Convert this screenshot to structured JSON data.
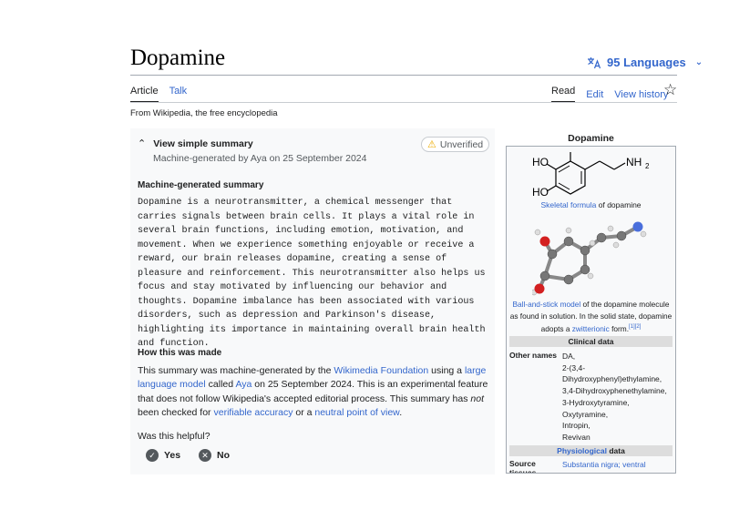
{
  "article": {
    "title": "Dopamine",
    "languages": "95 Languages",
    "tabs_left": [
      "Article",
      "Talk"
    ],
    "tabs_right": [
      "Read",
      "Edit",
      "View history"
    ],
    "tagline": "From Wikipedia, the free encyclopedia"
  },
  "summary": {
    "title": "View simple summary",
    "badge": "Unverified",
    "meta": "Machine-generated by Aya on 25 September 2024",
    "section_heading": "Machine-generated summary",
    "text": "Dopamine is a neurotransmitter, a chemical messenger that carries signals between brain cells. It plays a vital role in several brain functions, including emotion, motivation, and movement. When we experience something enjoyable or receive a reward, our brain releases dopamine, creating a sense of pleasure and reinforcement. This neurotransmitter also helps us focus and stay motivated by influencing our behavior and thoughts. Dopamine imbalance has been associated with various disorders, such as depression and Parkinson's disease, highlighting its importance in maintaining overall brain health and function.",
    "how_heading": "How this was made",
    "how": {
      "p1": "This summary was machine-generated by the ",
      "l1": "Wikimedia Foundation",
      "p2": " using a ",
      "l2": "large language model",
      "p3": " called ",
      "l3": "Aya",
      "p4": " on 25 September 2024. This is an experimental feature that does not follow Wikipedia's accepted editorial process. This summary has ",
      "em": "not",
      "p5": " been checked for ",
      "l4": "verifiable accuracy",
      "p6": " or a ",
      "l5": "neutral point of view",
      "p7": "."
    },
    "helpful_q": "Was this helpful?",
    "yes": "Yes",
    "no": "No"
  },
  "infobox": {
    "title": "Dopamine",
    "struct_labels": {
      "ho1": "HO",
      "ho2": "HO",
      "nh2": "NH",
      "sub": "2"
    },
    "cap1_link": "Skeletal formula",
    "cap1_rest": " of dopamine",
    "cap2_link1": "Ball-and-stick model",
    "cap2_text1": " of the dopamine molecule as found in solution. In the solid state, dopamine adopts a ",
    "cap2_link2": "zwitterionic",
    "cap2_text2": " form.",
    "cap2_refs": "[1][2]",
    "clinical_header": "Clinical data",
    "other_names_label": "Other names",
    "other_names": [
      "DA,",
      "2-(3,4-",
      "Dihydroxyphenyl)ethylamine,",
      "3,4-Dihydroxyphenethylamine,",
      "3-Hydroxytyramine,",
      "Oxytyramine,",
      "Intropin,",
      "Revivan"
    ],
    "physio_link": "Physiological",
    "physio_rest": " data",
    "source_label": "Source tissues",
    "source_vals": "Substantia nigra; ventral"
  },
  "icons": [
    "translate-icon",
    "chevron-down-icon",
    "star-icon",
    "chevron-up-icon",
    "warning-icon",
    "check-icon",
    "close-icon"
  ]
}
